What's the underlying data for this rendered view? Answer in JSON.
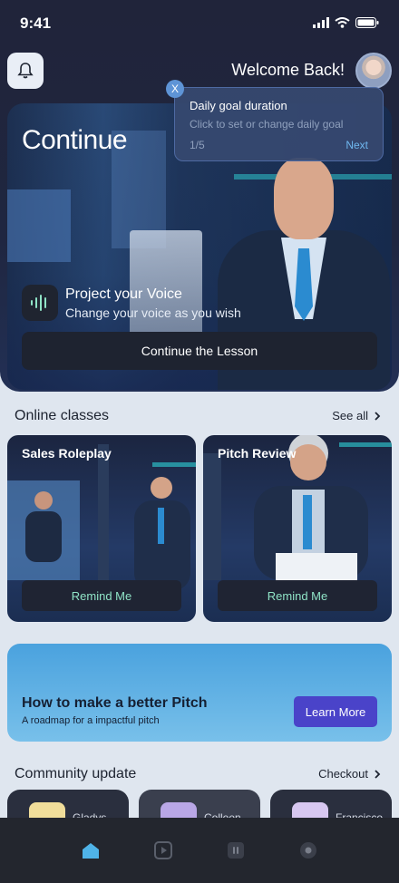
{
  "status": {
    "time": "9:41"
  },
  "header": {
    "welcome": "Welcome Back!"
  },
  "hero": {
    "title": "Continue",
    "voice_title": "Project your Voice",
    "voice_subtitle": "Change your voice as you wish",
    "continue_button": "Continue the Lesson"
  },
  "tooltip": {
    "close": "X",
    "title": "Daily goal duration",
    "subtitle": "Click to set or change daily goal",
    "step": "1/5",
    "next": "Next"
  },
  "online_classes": {
    "title": "Online classes",
    "see_all": "See all",
    "cards": [
      {
        "name": "Sales Roleplay",
        "button": "Remind Me"
      },
      {
        "name": "Pitch Review",
        "button": "Remind Me"
      }
    ]
  },
  "promo": {
    "title": "How to make a better Pitch",
    "subtitle": "A roadmap for a impactful pitch",
    "button": "Learn More"
  },
  "community": {
    "title": "Community update",
    "link": "Checkout",
    "members": [
      "Gladys",
      "Colleen",
      "Francisco"
    ]
  },
  "icons": {
    "bell": "bell-icon",
    "home": "home-icon",
    "play": "play-icon",
    "voice": "waveform-icon",
    "record": "record-icon"
  },
  "colors": {
    "accent": "#4a43c9",
    "remind_text": "#8fe3c6",
    "active_tab": "#4fb3e8"
  }
}
